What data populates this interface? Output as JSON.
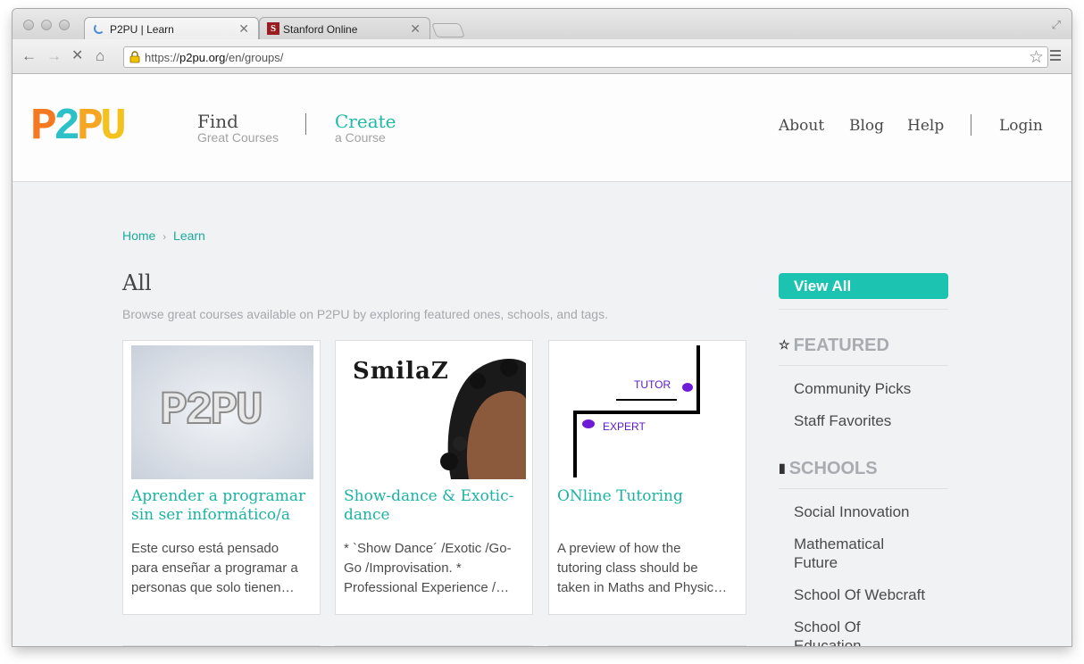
{
  "browser": {
    "tabs": [
      {
        "title": "P2PU | Learn",
        "state": "loading",
        "active": true
      },
      {
        "title": "Stanford Online",
        "favicon": "S",
        "active": false
      }
    ],
    "url": {
      "scheme": "https://",
      "domain": "p2pu.org",
      "path": "/en/groups/"
    },
    "icons": {
      "back": "back-arrow-icon",
      "forward": "forward-arrow-icon",
      "stop": "stop-icon",
      "home": "home-icon",
      "bookmark": "star-icon",
      "menu": "menu-icon",
      "secure": "lock-warning-icon"
    }
  },
  "header": {
    "logo": {
      "letters": [
        "P",
        "2",
        "P",
        "U"
      ],
      "colors": [
        "#f47920",
        "#2cc1c8",
        "#f5a623",
        "#f4c21f"
      ]
    },
    "find": {
      "title": "Find",
      "subtitle": "Great Courses"
    },
    "create": {
      "title": "Create",
      "subtitle": "a Course"
    },
    "links": [
      "About",
      "Blog",
      "Help"
    ],
    "login": "Login"
  },
  "breadcrumb": [
    "Home",
    "Learn"
  ],
  "main": {
    "title": "All",
    "subtitle": "Browse great courses available on P2PU by exploring featured ones, schools, and tags."
  },
  "courses": [
    {
      "title": "Aprender a programar sin ser informático/a",
      "description_lines": [
        "Este curso está pensado",
        "para enseñar a programar a",
        "personas que solo tienen…"
      ],
      "thumb_text": "P2PU"
    },
    {
      "title": "Show-dance & Exotic-dance",
      "description_lines": [
        "* `Show Dance´ /Exotic /Go-",
        "Go /Improvisation. *",
        "Professional Experience /…"
      ],
      "thumb_text": "SmilaZ"
    },
    {
      "title": "ONline Tutoring",
      "description_lines": [
        "A preview of how the",
        "tutoring class should be",
        "taken in Maths and Physic…"
      ],
      "thumb_labels": [
        "TUTOR",
        "EXPERT"
      ]
    }
  ],
  "sidebar": {
    "view_all": "View All",
    "featured": {
      "heading": "FEATURED",
      "icon": "star-icon",
      "items": [
        "Community Picks",
        "Staff Favorites"
      ]
    },
    "schools": {
      "heading": "SCHOOLS",
      "icon": "book-icon",
      "items": [
        "Social Innovation",
        "Mathematical Future",
        "School Of Webcraft",
        "School Of Education"
      ]
    }
  },
  "colors": {
    "accent": "#1bb3a3",
    "button": "#1dc3b1",
    "muted": "#a5a8ad"
  }
}
